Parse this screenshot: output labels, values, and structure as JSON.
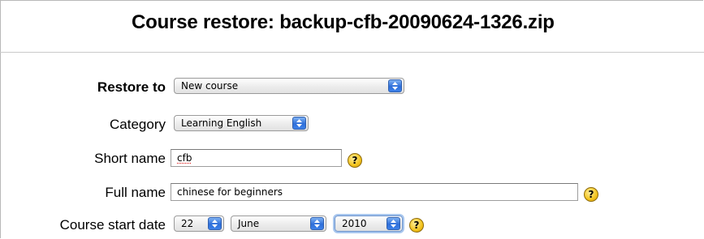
{
  "page": {
    "title": "Course restore: backup-cfb-20090624-1326.zip"
  },
  "form": {
    "restore_to": {
      "label": "Restore to",
      "value": "New course"
    },
    "category": {
      "label": "Category",
      "value": "Learning English"
    },
    "short_name": {
      "label": "Short name",
      "value": "cfb"
    },
    "full_name": {
      "label": "Full name",
      "value": "chinese for beginners"
    },
    "start_date": {
      "label": "Course start date",
      "day": "22",
      "month": "June",
      "year": "2010"
    },
    "help_icon_text": "?"
  },
  "colors": {
    "select_arrow_blue": "#2f6fd9",
    "help_yellow": "#f3c31c",
    "border_gray": "#c9c9c9"
  },
  "icons": {
    "select_arrows": "updown-arrows-icon",
    "help": "help-question-icon"
  }
}
